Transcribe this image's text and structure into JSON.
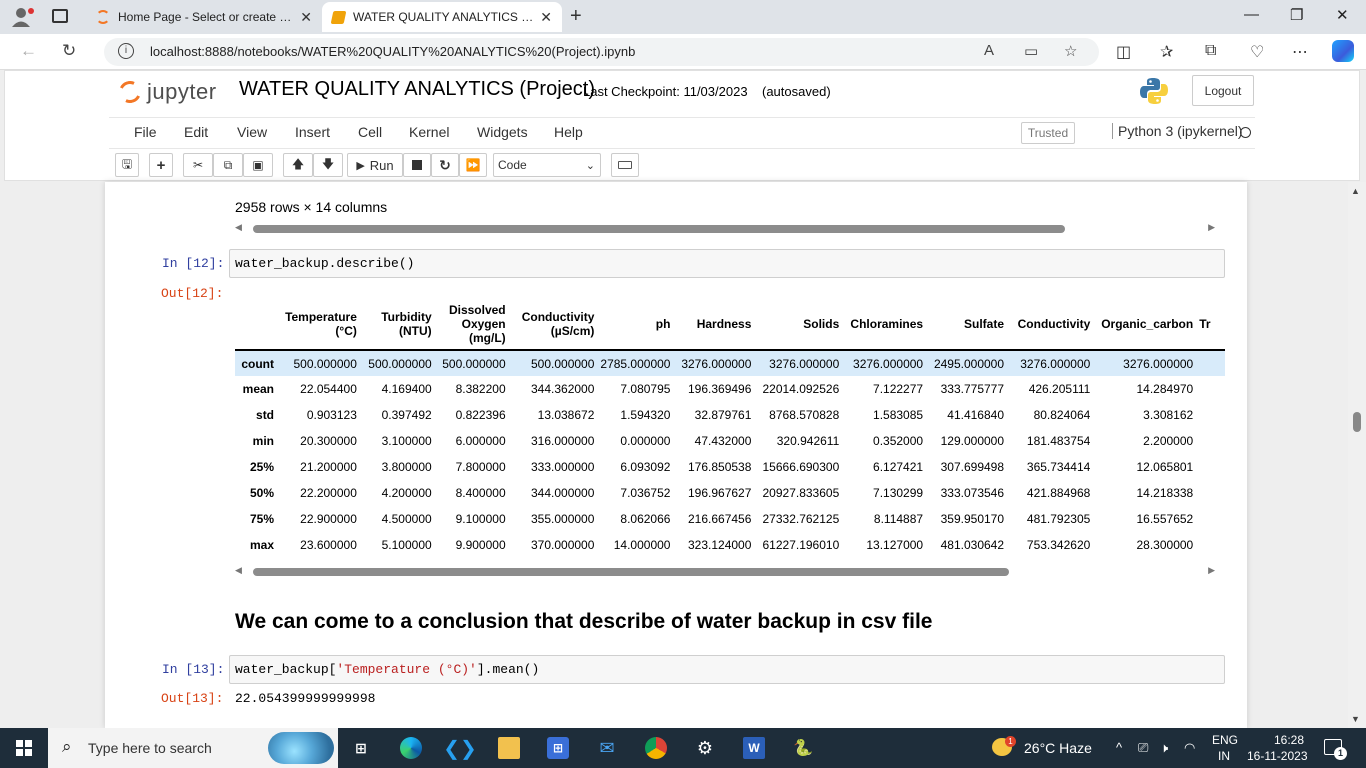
{
  "browser": {
    "tabs": [
      {
        "title": "Home Page - Select or create a n"
      },
      {
        "title": "WATER QUALITY ANALYTICS (Pro"
      }
    ],
    "url": "localhost:8888/notebooks/WATER%20QUALITY%20ANALYTICS%20(Project).ipynb",
    "new_tab_glyph": "+",
    "close_glyph": "✕"
  },
  "jupyter": {
    "logo_text": "jupyter",
    "notebook_name": "WATER QUALITY ANALYTICS (Project)",
    "checkpoint": "Last Checkpoint: 11/03/2023",
    "autosaved": "(autosaved)",
    "logout_label": "Logout",
    "menus": [
      "File",
      "Edit",
      "View",
      "Insert",
      "Cell",
      "Kernel",
      "Widgets",
      "Help"
    ],
    "trusted_label": "Trusted",
    "kernel_name": "Python 3 (ipykernel)",
    "toolbar": {
      "run_label": "Run",
      "cell_type": "Code"
    }
  },
  "notebook": {
    "prev_output": "2958 rows × 14 columns",
    "cell12": {
      "in_prompt": "In [12]:",
      "code": "water_backup.describe()",
      "out_prompt": "Out[12]:"
    },
    "describe_table": {
      "columns": [
        [
          "Temperature",
          "(°C)"
        ],
        [
          "Turbidity",
          "(NTU)"
        ],
        [
          "Dissolved",
          "Oxygen",
          "(mg/L)"
        ],
        [
          "Conductivity",
          "(µS/cm)"
        ],
        [
          "ph"
        ],
        [
          "Hardness"
        ],
        [
          "Solids"
        ],
        [
          "Chloramines"
        ],
        [
          "Sulfate"
        ],
        [
          "Conductivity"
        ],
        [
          "Organic_carbon"
        ],
        [
          "Tr"
        ]
      ],
      "rows": [
        {
          "label": "count",
          "values": [
            "500.000000",
            "500.000000",
            "500.000000",
            "500.000000",
            "2785.000000",
            "3276.000000",
            "3276.000000",
            "3276.000000",
            "2495.000000",
            "3276.000000",
            "3276.000000",
            ""
          ]
        },
        {
          "label": "mean",
          "values": [
            "22.054400",
            "4.169400",
            "8.382200",
            "344.362000",
            "7.080795",
            "196.369496",
            "22014.092526",
            "7.122277",
            "333.775777",
            "426.205111",
            "14.284970",
            ""
          ]
        },
        {
          "label": "std",
          "values": [
            "0.903123",
            "0.397492",
            "0.822396",
            "13.038672",
            "1.594320",
            "32.879761",
            "8768.570828",
            "1.583085",
            "41.416840",
            "80.824064",
            "3.308162",
            ""
          ]
        },
        {
          "label": "min",
          "values": [
            "20.300000",
            "3.100000",
            "6.000000",
            "316.000000",
            "0.000000",
            "47.432000",
            "320.942611",
            "0.352000",
            "129.000000",
            "181.483754",
            "2.200000",
            ""
          ]
        },
        {
          "label": "25%",
          "values": [
            "21.200000",
            "3.800000",
            "7.800000",
            "333.000000",
            "6.093092",
            "176.850538",
            "15666.690300",
            "6.127421",
            "307.699498",
            "365.734414",
            "12.065801",
            ""
          ]
        },
        {
          "label": "50%",
          "values": [
            "22.200000",
            "4.200000",
            "8.400000",
            "344.000000",
            "7.036752",
            "196.967627",
            "20927.833605",
            "7.130299",
            "333.073546",
            "421.884968",
            "14.218338",
            ""
          ]
        },
        {
          "label": "75%",
          "values": [
            "22.900000",
            "4.500000",
            "9.100000",
            "355.000000",
            "8.062066",
            "216.667456",
            "27332.762125",
            "8.114887",
            "359.950170",
            "481.792305",
            "16.557652",
            ""
          ]
        },
        {
          "label": "max",
          "values": [
            "23.600000",
            "5.100000",
            "9.900000",
            "370.000000",
            "14.000000",
            "323.124000",
            "61227.196010",
            "13.127000",
            "481.030642",
            "753.342620",
            "28.300000",
            ""
          ]
        }
      ]
    },
    "conclusion": "We can come to a conclusion that describe of water backup in csv file",
    "cell13": {
      "in_prompt": "In [13]:",
      "code_prefix": "water_backup[",
      "code_string": "'Temperature (°C)'",
      "code_suffix": "].mean()",
      "out_prompt": "Out[13]:",
      "output": "22.054399999999998"
    }
  },
  "taskbar": {
    "search_placeholder": "Type here to search",
    "weather": "26°C  Haze",
    "weather_badge": "1",
    "lang_line1": "ENG",
    "lang_line2": "IN",
    "time": "16:28",
    "date": "16-11-2023",
    "notification_count": "1"
  },
  "colors": {
    "jupyter_orange": "#f37726",
    "prompt_in": "#303f9f",
    "prompt_out": "#d84315",
    "row_highlight": "#d8ebfa",
    "taskbar": "#1e2d3a"
  }
}
